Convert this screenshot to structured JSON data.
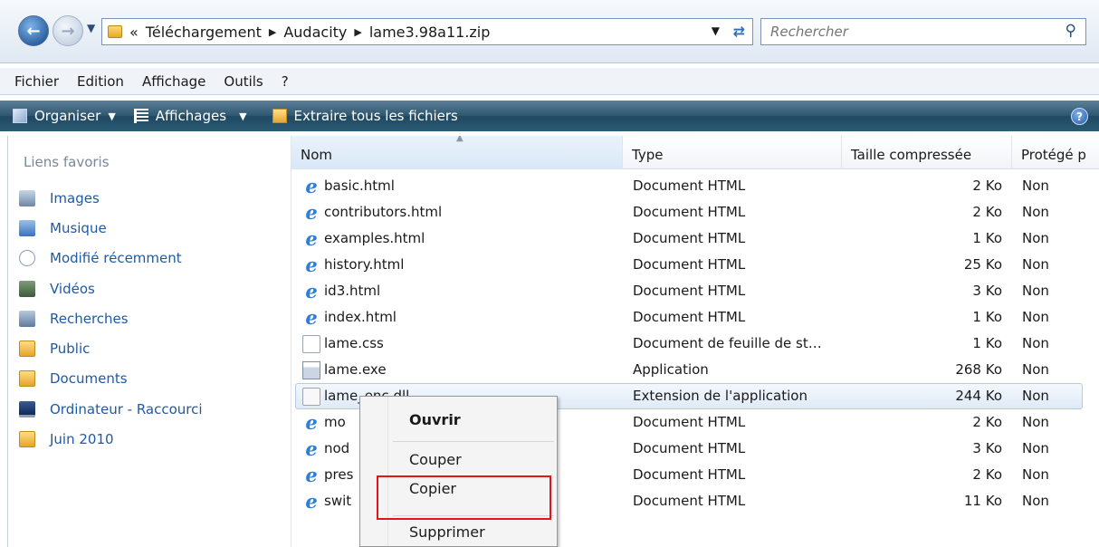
{
  "address_bar": {
    "overflow": "«",
    "crumbs": [
      "Téléchargement",
      "Audacity",
      "lame3.98a11.zip"
    ],
    "search_placeholder": "Rechercher"
  },
  "menu": [
    "Fichier",
    "Edition",
    "Affichage",
    "Outils",
    "?"
  ],
  "commands": {
    "organize": "Organiser",
    "views": "Affichages",
    "extract": "Extraire tous les fichiers",
    "help": "?"
  },
  "nav": {
    "heading": "Liens favoris",
    "items": [
      {
        "label": "Images",
        "icon": "images-icon"
      },
      {
        "label": "Musique",
        "icon": "music-icon"
      },
      {
        "label": "Modifié récemment",
        "icon": "recent-icon"
      },
      {
        "label": "Vidéos",
        "icon": "videos-icon"
      },
      {
        "label": "Recherches",
        "icon": "searches-icon"
      },
      {
        "label": "Public",
        "icon": "folder-icon"
      },
      {
        "label": "Documents",
        "icon": "folder-icon"
      },
      {
        "label": "Ordinateur - Raccourci",
        "icon": "computer-icon"
      },
      {
        "label": "Juin 2010",
        "icon": "folder-icon"
      }
    ]
  },
  "columns": {
    "name": "Nom",
    "type": "Type",
    "size": "Taille compressée",
    "protected": "Protégé p"
  },
  "files": [
    {
      "name": "basic.html",
      "type": "Document HTML",
      "size": "2 Ko",
      "protected": "Non",
      "icon": "ie-icon"
    },
    {
      "name": "contributors.html",
      "type": "Document HTML",
      "size": "2 Ko",
      "protected": "Non",
      "icon": "ie-icon"
    },
    {
      "name": "examples.html",
      "type": "Document HTML",
      "size": "1 Ko",
      "protected": "Non",
      "icon": "ie-icon"
    },
    {
      "name": "history.html",
      "type": "Document HTML",
      "size": "25 Ko",
      "protected": "Non",
      "icon": "ie-icon"
    },
    {
      "name": "id3.html",
      "type": "Document HTML",
      "size": "3 Ko",
      "protected": "Non",
      "icon": "ie-icon"
    },
    {
      "name": "index.html",
      "type": "Document HTML",
      "size": "1 Ko",
      "protected": "Non",
      "icon": "ie-icon"
    },
    {
      "name": "lame.css",
      "type": "Document de feuille de st…",
      "size": "1 Ko",
      "protected": "Non",
      "icon": "css-icon"
    },
    {
      "name": "lame.exe",
      "type": "Application",
      "size": "268 Ko",
      "protected": "Non",
      "icon": "exe-icon"
    },
    {
      "name": "lame_enc.dll",
      "type": "Extension de l'application",
      "size": "244 Ko",
      "protected": "Non",
      "icon": "dll-icon",
      "selected": true
    },
    {
      "name": "mo",
      "type": "Document HTML",
      "size": "2 Ko",
      "protected": "Non",
      "icon": "ie-icon"
    },
    {
      "name": "nod",
      "type": "Document HTML",
      "size": "3 Ko",
      "protected": "Non",
      "icon": "ie-icon"
    },
    {
      "name": "pres",
      "type": "Document HTML",
      "size": "2 Ko",
      "protected": "Non",
      "icon": "ie-icon"
    },
    {
      "name": "swit",
      "type": "Document HTML",
      "size": "11 Ko",
      "protected": "Non",
      "icon": "ie-icon"
    }
  ],
  "context_menu": {
    "open": "Ouvrir",
    "cut": "Couper",
    "copy": "Copier",
    "delete": "Supprimer"
  },
  "colors": {
    "highlight_box": "#e2151b",
    "link_blue": "#1f5aa3",
    "command_bar": "#2d566f"
  }
}
